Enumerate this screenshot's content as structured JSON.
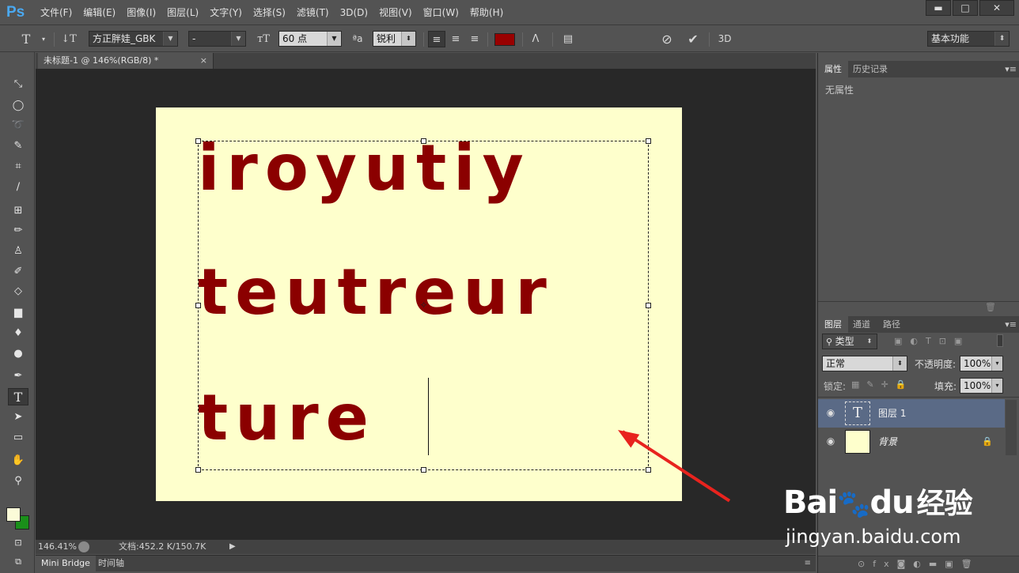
{
  "app": {
    "logo": "Ps"
  },
  "menu": [
    "文件(F)",
    "编辑(E)",
    "图像(I)",
    "图层(L)",
    "文字(Y)",
    "选择(S)",
    "滤镜(T)",
    "3D(D)",
    "视图(V)",
    "窗口(W)",
    "帮助(H)"
  ],
  "window_buttons": {
    "minimize": "▬",
    "maximize": "□",
    "close": "✕"
  },
  "options": {
    "font_family": "方正胖娃_GBK",
    "font_style": "-",
    "font_size": "60 点",
    "aa_label": "ªa",
    "anti_alias": "锐利",
    "text_color": "#990000",
    "workspace": "基本功能"
  },
  "document": {
    "tab_title": "未标题-1 @ 146%(RGB/8) *",
    "tab_close": "×",
    "canvas_color": "#feffcc",
    "text_lines": [
      "iroyutiy",
      "teutreur",
      "ture"
    ],
    "text_color": "#8b0000"
  },
  "status": {
    "zoom": "146.41%",
    "doc_info": "文档:452.2 K/150.7K"
  },
  "bottom_tabs": [
    "Mini Bridge",
    "时间轴"
  ],
  "properties_panel": {
    "tabs": [
      "属性",
      "历史记录"
    ],
    "content": "无属性"
  },
  "layers_panel": {
    "tabs": [
      "图层",
      "通道",
      "路径"
    ],
    "filter_label": "类型",
    "blend_mode": "正常",
    "opacity_label": "不透明度:",
    "opacity": "100%",
    "lock_label": "锁定:",
    "fill_label": "填充:",
    "fill": "100%",
    "layers": [
      {
        "name": "图层 1",
        "type": "text",
        "selected": true
      },
      {
        "name": "背景",
        "type": "background",
        "locked": true
      }
    ]
  },
  "colors": {
    "foreground": "#fbfbd8",
    "background": "#1a8f1a"
  },
  "watermark": {
    "brand": "Bai",
    "brand2": "du",
    "brand3": "经验",
    "url": "jingyan.baidu.com"
  }
}
